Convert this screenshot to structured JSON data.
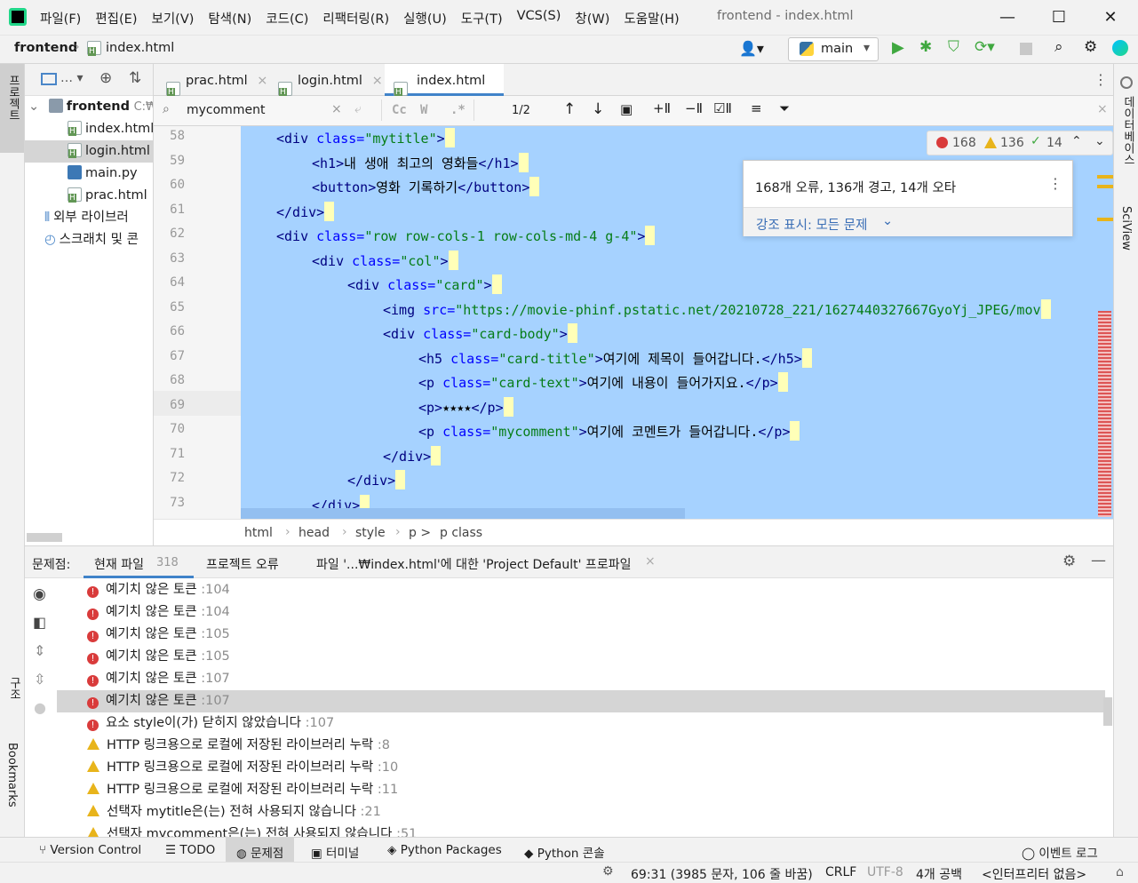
{
  "titlebar": {
    "menu": [
      "파일(F)",
      "편집(E)",
      "보기(V)",
      "탐색(N)",
      "코드(C)",
      "리팩터링(R)",
      "실행(U)",
      "도구(T)",
      "VCS(S)",
      "창(W)",
      "도움말(H)"
    ],
    "title": "frontend - index.html",
    "minimize": "—",
    "maximize": "☐",
    "close": "✕"
  },
  "navbar": {
    "project": "frontend",
    "file": "index.html",
    "branch": "main"
  },
  "project_tree": {
    "root": "frontend",
    "root_path": "C:₩",
    "files": [
      "index.html",
      "login.html",
      "main.py",
      "prac.html"
    ],
    "external_libs": "외부 라이브러",
    "scratches": "스크래치 및 콘"
  },
  "left_strip": {
    "project_label": "프로젝트",
    "structure_label": "구조",
    "bookmarks_label": "Bookmarks"
  },
  "right_strip": {
    "db_label": "데이터베이스",
    "sciview_label": "SciView"
  },
  "tabs": [
    {
      "label": "prac.html"
    },
    {
      "label": "login.html"
    },
    {
      "label": "index.html"
    }
  ],
  "find": {
    "query": "mycomment",
    "match_count": "1/2",
    "cc": "Cc",
    "w": "W",
    "regex": ".*"
  },
  "code_lines": [
    {
      "n": "58",
      "indent": 1,
      "parts": [
        [
          "tag",
          "<div "
        ],
        [
          "attr",
          "class="
        ],
        [
          "str",
          "\"mytitle\""
        ],
        [
          "tag",
          ">"
        ]
      ]
    },
    {
      "n": "59",
      "indent": 2,
      "parts": [
        [
          "tag",
          "<h1>"
        ],
        [
          "txt",
          "내 생애 최고의 영화들"
        ],
        [
          "tag",
          "</h1>"
        ]
      ]
    },
    {
      "n": "60",
      "indent": 2,
      "parts": [
        [
          "tag",
          "<button>"
        ],
        [
          "txt",
          "영화 기록하기"
        ],
        [
          "tag",
          "</button>"
        ]
      ]
    },
    {
      "n": "61",
      "indent": 1,
      "parts": [
        [
          "tag",
          "</div>"
        ]
      ]
    },
    {
      "n": "62",
      "indent": 1,
      "parts": [
        [
          "tag",
          "<div "
        ],
        [
          "attr",
          "class="
        ],
        [
          "str",
          "\"row row-cols-1 row-cols-md-4 g-4\""
        ],
        [
          "tag",
          ">"
        ]
      ]
    },
    {
      "n": "63",
      "indent": 2,
      "parts": [
        [
          "tag",
          "<div "
        ],
        [
          "attr",
          "class="
        ],
        [
          "str",
          "\"col\""
        ],
        [
          "tag",
          ">"
        ]
      ]
    },
    {
      "n": "64",
      "indent": 3,
      "parts": [
        [
          "tag",
          "<div "
        ],
        [
          "attr",
          "class="
        ],
        [
          "str",
          "\"card\""
        ],
        [
          "tag",
          ">"
        ]
      ]
    },
    {
      "n": "65",
      "indent": 4,
      "parts": [
        [
          "tag",
          "<img "
        ],
        [
          "attr",
          "src="
        ],
        [
          "str",
          "\"https://movie-phinf.pstatic.net/20210728_221/1627440327667GyoYj_JPEG/mov"
        ]
      ]
    },
    {
      "n": "66",
      "indent": 4,
      "parts": [
        [
          "tag",
          "<div "
        ],
        [
          "attr",
          "class="
        ],
        [
          "str",
          "\"card-body\""
        ],
        [
          "tag",
          ">"
        ]
      ]
    },
    {
      "n": "67",
      "indent": 5,
      "parts": [
        [
          "tag",
          "<h5 "
        ],
        [
          "attr",
          "class="
        ],
        [
          "str",
          "\"card-title\""
        ],
        [
          "tag",
          ">"
        ],
        [
          "txt",
          "여기에 제목이 들어갑니다."
        ],
        [
          "tag",
          "</h5>"
        ]
      ]
    },
    {
      "n": "68",
      "indent": 5,
      "parts": [
        [
          "tag",
          "<p "
        ],
        [
          "attr",
          "class="
        ],
        [
          "str",
          "\"card-text\""
        ],
        [
          "tag",
          ">"
        ],
        [
          "txt",
          "여기에 내용이 들어가지요."
        ],
        [
          "tag",
          "</p>"
        ]
      ]
    },
    {
      "n": "69",
      "indent": 5,
      "parts": [
        [
          "tag",
          "<p>"
        ],
        [
          "txt",
          "⭑⭑⭑⭑"
        ],
        [
          "tag",
          "</p>"
        ]
      ]
    },
    {
      "n": "70",
      "indent": 5,
      "parts": [
        [
          "tag",
          "<p "
        ],
        [
          "attr",
          "class="
        ],
        [
          "str",
          "\"mycomment\""
        ],
        [
          "tag",
          ">"
        ],
        [
          "txt",
          "여기에 코멘트가 들어갑니다."
        ],
        [
          "tag",
          "</p>"
        ]
      ]
    },
    {
      "n": "71",
      "indent": 4,
      "parts": [
        [
          "tag",
          "</div>"
        ]
      ]
    },
    {
      "n": "72",
      "indent": 3,
      "parts": [
        [
          "tag",
          "</div>"
        ]
      ]
    },
    {
      "n": "73",
      "indent": 2,
      "parts": [
        [
          "tag",
          "</div>"
        ]
      ]
    }
  ],
  "inspection": {
    "errors": "168",
    "warnings": "136",
    "typos": "14"
  },
  "popup": {
    "summary": "168개 오류, 136개 경고, 14개 오타",
    "highlight": "강조 표시: 모든 문제"
  },
  "breadcrumb": [
    "html",
    "head",
    "style",
    "p >",
    "p class"
  ],
  "problems": {
    "title": "문제점:",
    "tab_current": "현재 파일",
    "tab_current_count": "318",
    "tab_project": "프로젝트 오류",
    "tab_profile": "파일 '...₩index.html'에 대한 'Project Default' 프로파일",
    "rows": [
      {
        "type": "error",
        "text": "예기치 않은 토큰",
        "loc": ":104"
      },
      {
        "type": "error",
        "text": "예기치 않은 토큰",
        "loc": ":104"
      },
      {
        "type": "error",
        "text": "예기치 않은 토큰",
        "loc": ":105"
      },
      {
        "type": "error",
        "text": "예기치 않은 토큰",
        "loc": ":105"
      },
      {
        "type": "error",
        "text": "예기치 않은 토큰",
        "loc": ":107"
      },
      {
        "type": "error",
        "text": "예기치 않은 토큰",
        "loc": ":107",
        "selected": true
      },
      {
        "type": "error",
        "text": "요소 style이(가) 닫히지 않았습니다",
        "loc": ":107"
      },
      {
        "type": "warn",
        "text": "HTTP 링크용으로 로컬에 저장된 라이브러리 누락",
        "loc": ":8"
      },
      {
        "type": "warn",
        "text": "HTTP 링크용으로 로컬에 저장된 라이브러리 누락",
        "loc": ":10"
      },
      {
        "type": "warn",
        "text": "HTTP 링크용으로 로컬에 저장된 라이브러리 누락",
        "loc": ":11"
      },
      {
        "type": "warn",
        "text": "선택자 mytitle은(는) 전혀 사용되지 않습니다",
        "loc": ":21"
      },
      {
        "type": "warn",
        "text": "선택자 mycomment은(는) 전혀 사용되지 않습니다",
        "loc": ":51"
      }
    ]
  },
  "bottom_tools": {
    "vcs": "Version Control",
    "todo": "TODO",
    "problems": "문제점",
    "terminal": "터미널",
    "packages": "Python Packages",
    "console": "Python 콘솔",
    "event_log": "이벤트 로그"
  },
  "status": {
    "position": "69:31 (3985 문자, 106 줄 바꿈)",
    "line_sep": "CRLF",
    "encoding": "UTF-8",
    "indent": "4개 공백",
    "interpreter": "<인터프리터 없음>"
  },
  "colors": {
    "selection": "#a6d2ff",
    "accent": "#4083c9",
    "error": "#d93b3b",
    "warning": "#e8b41b"
  }
}
